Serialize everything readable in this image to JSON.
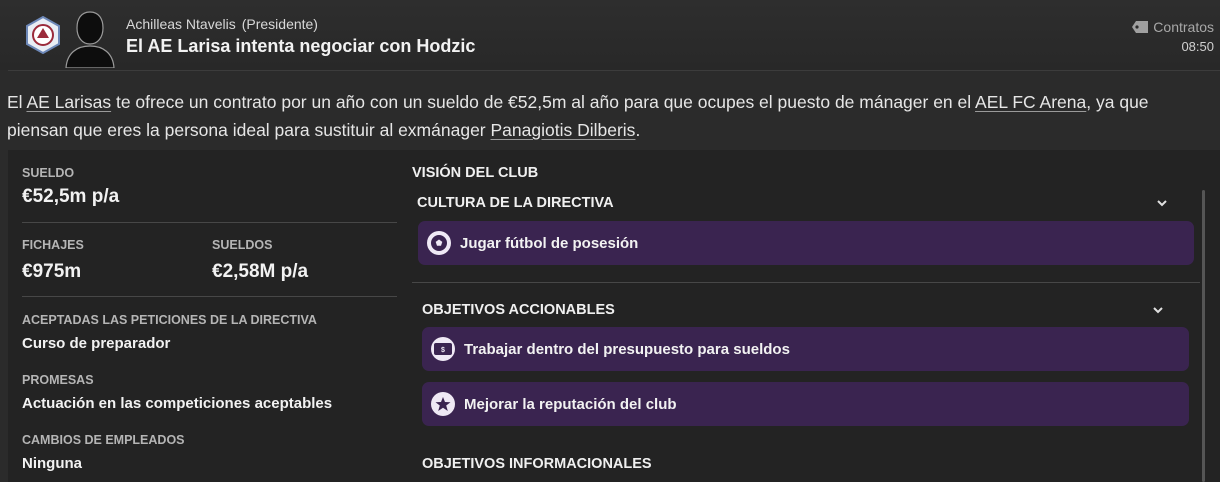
{
  "header": {
    "sender_name": "Achilleas Ntavelis",
    "sender_role": "(Presidente)",
    "subject": "El AE Larisa intenta negociar con Hodzic",
    "category": "Contratos",
    "time": "08:50",
    "club_badge_icon": "ae-larisa-crest-icon",
    "avatar_icon": "person-silhouette-icon"
  },
  "message": {
    "p1": "El ",
    "club_link": "AE Larisas",
    "p2": " te ofrece un contrato por un año con un sueldo de €52,5m al año para que ocupes el puesto de mánager en el ",
    "stadium_link": "AEL FC Arena",
    "p3": ", ya que piensan que eres la persona ideal para sustituir al exmánager ",
    "manager_link": "Panagiotis Dilberis",
    "p4": "."
  },
  "contract": {
    "salary_label": "SUELDO",
    "salary_value": "€52,5m p/a",
    "transfers_label": "FICHAJES",
    "transfers_value": "€975m",
    "wages_label": "SUELDOS",
    "wages_value": "€2,58M p/a",
    "board_requests_label": "ACEPTADAS LAS PETICIONES DE LA DIRECTIVA",
    "board_requests_value": "Curso de preparador",
    "promises_label": "PROMESAS",
    "promises_value": "Actuación en las competiciones aceptables",
    "staff_changes_label": "CAMBIOS DE EMPLEADOS",
    "staff_changes_value": "Ninguna"
  },
  "vision": {
    "title": "VISIÓN DEL CLUB",
    "culture_title": "CULTURA DE LA DIRECTIVA",
    "culture_items": [
      {
        "label": "Jugar fútbol de posesión",
        "icon": "football-icon"
      }
    ],
    "actionable_title": "OBJETIVOS ACCIONABLES",
    "actionable_items": [
      {
        "label": "Trabajar dentro del presupuesto para sueldos",
        "icon": "wage-budget-icon"
      },
      {
        "label": "Mejorar la reputación del club",
        "icon": "star-icon"
      }
    ],
    "informational_title": "OBJETIVOS INFORMACIONALES"
  },
  "colors": {
    "pill_background": "#3a2450",
    "panel_background": "#232323",
    "page_background": "#2b2b2b"
  }
}
